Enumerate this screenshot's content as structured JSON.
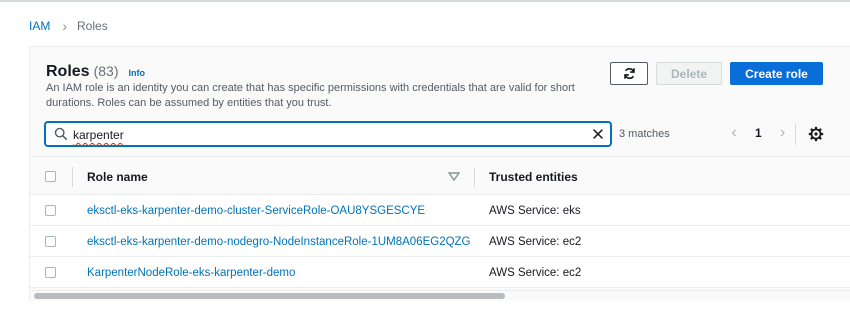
{
  "breadcrumb": {
    "root": "IAM",
    "current": "Roles"
  },
  "header": {
    "title": "Roles",
    "count": "(83)",
    "info": "Info",
    "description": "An IAM role is an identity you can create that has specific permissions with credentials that are valid for short durations. Roles can be assumed by entities that you trust."
  },
  "actions": {
    "refresh_icon": "refresh-icon",
    "delete_label": "Delete",
    "create_label": "Create role"
  },
  "search": {
    "value": "karpenter",
    "matches": "3 matches"
  },
  "pagination": {
    "page": "1"
  },
  "table": {
    "columns": [
      "Role name",
      "Trusted entities"
    ],
    "rows": [
      {
        "name": "eksctl-eks-karpenter-demo-cluster-ServiceRole-OAU8YSGESCYE",
        "trusted": "AWS Service: eks"
      },
      {
        "name": "eksctl-eks-karpenter-demo-nodegro-NodeInstanceRole-1UM8A06EG2QZG",
        "trusted": "AWS Service: ec2"
      },
      {
        "name": "KarpenterNodeRole-eks-karpenter-demo",
        "trusted": "AWS Service: ec2"
      }
    ]
  },
  "colors": {
    "link": "#0073bb",
    "primary": "#0a6ed9",
    "border": "#eaeded"
  }
}
